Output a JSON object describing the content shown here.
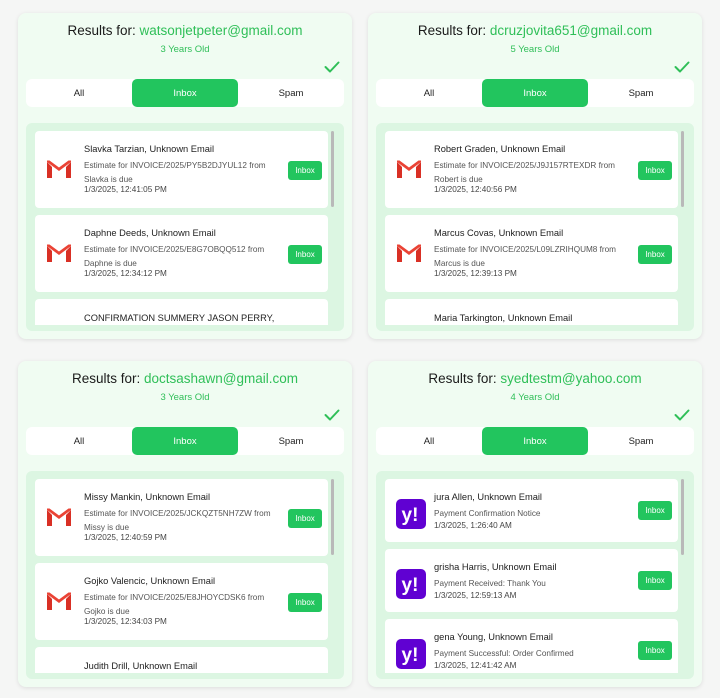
{
  "results_prefix": "Results for:",
  "tabs": [
    "All",
    "Inbox",
    "Spam"
  ],
  "btn_label": "Inbox",
  "cards": [
    {
      "email": "watsonjetpeter@gmail.com",
      "age": "3 Years Old",
      "provider": "gmail",
      "items": [
        {
          "sender": "Slavka Tarzian, Unknown Email",
          "subject": "Estimate for INVOICE/2025/PY5B2DJYUL12 from Slavka is due",
          "time": "1/3/2025, 12:41:05 PM"
        },
        {
          "sender": "Daphne Deeds, Unknown Email",
          "subject": "Estimate for INVOICE/2025/E8G7OBQQ512 from Daphne is due",
          "time": "1/3/2025, 12:34:12 PM"
        },
        {
          "sender": "CONFIRMATION SUMMERY JASON PERRY,",
          "subject": "",
          "time": ""
        }
      ]
    },
    {
      "email": "dcruzjovita651@gmail.com",
      "age": "5 Years Old",
      "provider": "gmail",
      "items": [
        {
          "sender": "Robert Graden, Unknown Email",
          "subject": "Estimate for INVOICE/2025/J9J157RTEXDR from Robert is due",
          "time": "1/3/2025, 12:40:56 PM"
        },
        {
          "sender": "Marcus Covas, Unknown Email",
          "subject": "Estimate for INVOICE/2025/L09LZRIHQUM8 from Marcus is due",
          "time": "1/3/2025, 12:39:13 PM"
        },
        {
          "sender": "Maria Tarkington, Unknown Email",
          "subject": "",
          "time": ""
        }
      ]
    },
    {
      "email": "doctsashawn@gmail.com",
      "age": "3 Years Old",
      "provider": "gmail",
      "items": [
        {
          "sender": "Missy Mankin, Unknown Email",
          "subject": "Estimate for INVOICE/2025/JCKQZT5NH7ZW from Missy is due",
          "time": "1/3/2025, 12:40:59 PM"
        },
        {
          "sender": "Gojko Valencic, Unknown Email",
          "subject": "Estimate for INVOICE/2025/E8JHOYCDSK6 from Gojko is due",
          "time": "1/3/2025, 12:34:03 PM"
        },
        {
          "sender": "Judith Drill, Unknown Email",
          "subject": "",
          "time": ""
        }
      ]
    },
    {
      "email": "syedtestm@yahoo.com",
      "age": "4 Years Old",
      "provider": "yahoo",
      "items": [
        {
          "sender": "jura Allen, Unknown Email",
          "subject": "Payment Confirmation Notice",
          "time": "1/3/2025, 1:26:40 AM"
        },
        {
          "sender": "grisha Harris, Unknown Email",
          "subject": "Payment Received: Thank You",
          "time": "1/3/2025, 12:59:13 AM"
        },
        {
          "sender": "gena Young, Unknown Email",
          "subject": "Payment Successful: Order Confirmed",
          "time": "1/3/2025, 12:41:42 AM"
        }
      ]
    }
  ],
  "colors": {
    "accent": "#22c55e",
    "accent_text": "#2fbf58",
    "card_bg": "#f0fcf2",
    "list_bg": "#dcf6e2"
  }
}
